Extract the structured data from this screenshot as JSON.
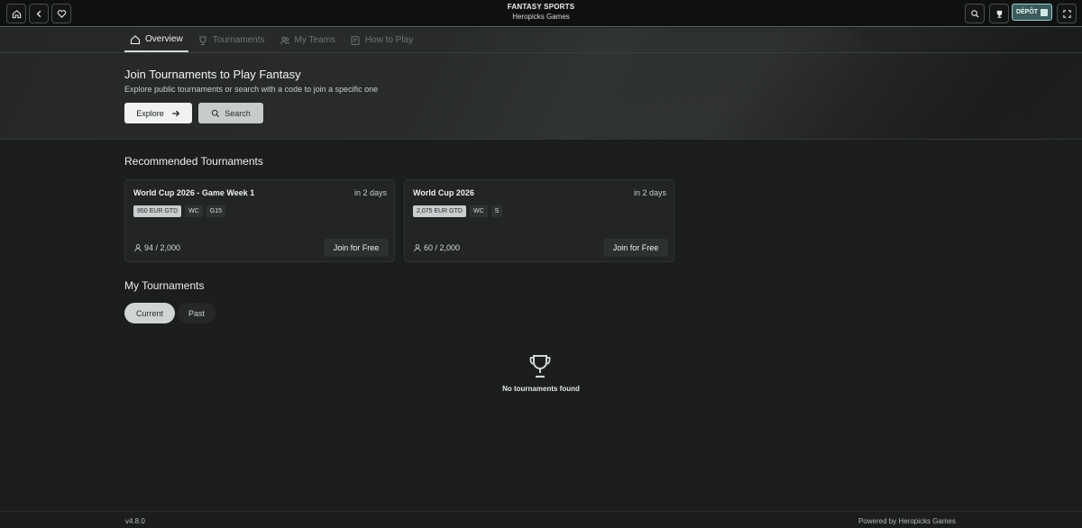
{
  "topbar": {
    "title": "FANTASY SPORTS",
    "subtitle": "Heropicks Games",
    "deposit_label": "DÉPÔT"
  },
  "nav": {
    "tabs": [
      {
        "label": "Overview",
        "icon": "home-icon"
      },
      {
        "label": "Tournaments",
        "icon": "trophy-icon"
      },
      {
        "label": "My Teams",
        "icon": "teams-icon"
      },
      {
        "label": "How to Play",
        "icon": "book-icon"
      }
    ]
  },
  "hero": {
    "title": "Join Tournaments to Play Fantasy",
    "subtitle": "Explore public tournaments or search with a code to join a specific one",
    "explore_label": "Explore",
    "search_label": "Search"
  },
  "recommended": {
    "title": "Recommended Tournaments",
    "cards": [
      {
        "name": "World Cup 2026 - Game Week 1",
        "time": "in 2 days",
        "tags": [
          "950 EUR GTD",
          "WC",
          "G15"
        ],
        "count": "94 / 2,000",
        "join_label": "Join for Free"
      },
      {
        "name": "World Cup 2026",
        "time": "in 2 days",
        "tags": [
          "2,075 EUR GTD",
          "WC",
          "S"
        ],
        "count": "60 / 2,000",
        "join_label": "Join for Free"
      }
    ]
  },
  "my_tournaments": {
    "title": "My Tournaments",
    "filters": [
      "Current",
      "Past"
    ],
    "empty_text": "No tournaments found"
  },
  "footer": {
    "version": "v4.8.0",
    "powered": "Powered by Heropicks Games"
  }
}
